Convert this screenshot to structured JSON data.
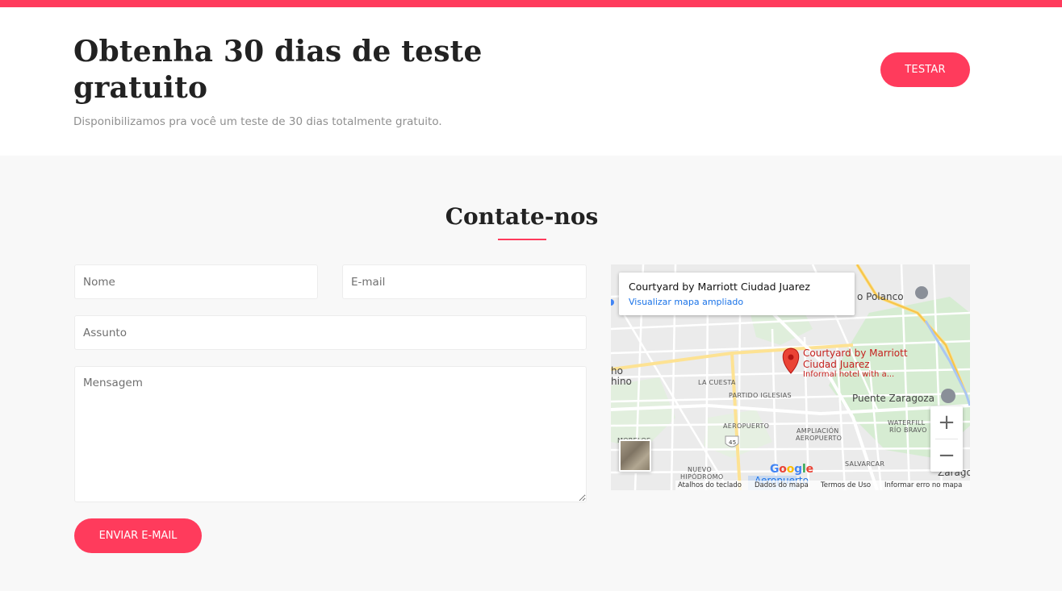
{
  "colors": {
    "accent": "#ff3b5c",
    "section_bg": "#f8f8f8",
    "text_dark": "#222222",
    "text_muted": "#8f8f8f"
  },
  "promo": {
    "title": "Obtenha 30 dias de teste gratuito",
    "subtitle": "Disponibilizamos pra você um teste de 30 dias totalmente gratuito.",
    "button_label": "Testar"
  },
  "contact": {
    "title": "Contate-nos",
    "fields": {
      "name_placeholder": "Nome",
      "email_placeholder": "E-mail",
      "subject_placeholder": "Assunto",
      "message_placeholder": "Mensagem"
    },
    "send_label": "Enviar E-mail"
  },
  "map": {
    "info_title": "Courtyard by Marriott Ciudad Juarez",
    "info_link": "Visualizar mapa ampliado",
    "poi_line1": "Courtyard by Marriott",
    "poi_line2": "Ciudad Juarez",
    "poi_desc": "Informal hotel with a...",
    "labels": {
      "polanco": "o Polanco",
      "ho": "ho",
      "hino": "hino",
      "la_cuesta": "LA CUESTA",
      "partido_iglesias": "PARTIDO IGLESIAS",
      "puente_zaragoza": "Puente Zaragoza",
      "aeropuerto": "AEROPUERTO",
      "ampliacion_1": "AMPLIACIÓN",
      "ampliacion_2": "AEROPUERTO",
      "waterfill_1": "WATERFILL",
      "waterfill_2": "RÍO BRAVO",
      "morelos": "MORELOS",
      "nuevo_1": "NUEVO",
      "nuevo_2": "HIPÓDROMO",
      "salvarcar": "SALVARCAR",
      "zaragoza": "Zaragoza",
      "aeropuerto_blue": "Aeropuerto",
      "route": "45"
    },
    "zoom_in": "+",
    "zoom_out": "−",
    "google": [
      "G",
      "o",
      "o",
      "g",
      "l",
      "e"
    ],
    "google_colors": [
      "#4285f4",
      "#ea4335",
      "#fbbc05",
      "#4285f4",
      "#34a853",
      "#ea4335"
    ],
    "attribution": {
      "shortcuts": "Atalhos do teclado",
      "data": "Dados do mapa",
      "terms": "Termos de Uso",
      "report": "Informar erro no mapa"
    }
  }
}
